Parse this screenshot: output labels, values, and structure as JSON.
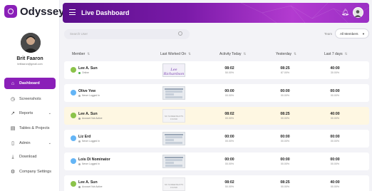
{
  "brand": {
    "name": "Odyssey"
  },
  "profile": {
    "name": "Brit Faaron",
    "email": "britfaaron@gmail.com"
  },
  "nav": [
    {
      "label": "Dashboard",
      "icon": "home-icon",
      "active": true
    },
    {
      "label": "Screenshots",
      "icon": "clock-icon"
    },
    {
      "label": "Reports",
      "icon": "chart-line-icon",
      "chevron": true
    },
    {
      "label": "Tables & Projects",
      "icon": "clipboard-icon"
    },
    {
      "label": "Admin",
      "icon": "document-icon",
      "chevron": true
    },
    {
      "label": "Download",
      "icon": "download-icon"
    },
    {
      "label": "Company Settings",
      "icon": "settings-icon"
    }
  ],
  "header": {
    "title": "Live Dashboard"
  },
  "toolbar": {
    "search_placeholder": "Search User",
    "team_label": "Team",
    "team_value": "All Members"
  },
  "columns": {
    "member": "Member",
    "last_worked": "Last Worked On",
    "today": "Activity Today",
    "yesterday": "Yesterday",
    "last7": "Last 7 days"
  },
  "rows": [
    {
      "name": "Lee A. Sun",
      "status": "Online",
      "status_color": "#4caf50",
      "avatar_color": "#8bc34a",
      "thumb": "signature",
      "thumb_text": "Lee Richardson",
      "today": "08:02",
      "today_pct": "50.00%",
      "yesterday": "08:25",
      "yesterday_pct": "87.00%",
      "last7": "40:00",
      "last7_pct": "30.00%"
    },
    {
      "name": "Olive Yew",
      "status": "Never Logged In",
      "status_color": "#b0b0b0",
      "avatar_color": "#64b5f6",
      "thumb": "screen",
      "thumb_text": "",
      "today": "00:00",
      "today_pct": "00.00%",
      "yesterday": "00:00",
      "yesterday_pct": "00.00%",
      "last7": "00:00",
      "last7_pct": "00.00%"
    },
    {
      "name": "Lee A. Sun",
      "status": "Account Not Active",
      "status_color": "#9e9e9e",
      "avatar_color": "#8bc34a",
      "thumb": "none",
      "thumb_text": "NO SCREENSHOTS FOUND",
      "today": "08:02",
      "today_pct": "00.00%",
      "yesterday": "08:25",
      "yesterday_pct": "00.00%",
      "last7": "40:00",
      "last7_pct": "00.00%",
      "highlight": true
    },
    {
      "name": "Liz Erd",
      "status": "Never Logged In",
      "status_color": "#b0b0b0",
      "avatar_color": "#64b5f6",
      "thumb": "screen",
      "thumb_text": "",
      "today": "00:00",
      "today_pct": "00.00%",
      "yesterday": "00:00",
      "yesterday_pct": "00.00%",
      "last7": "00:00",
      "last7_pct": "00.00%"
    },
    {
      "name": "Lois Di Nominator",
      "status": "Never Logged In",
      "status_color": "#b0b0b0",
      "avatar_color": "#64b5f6",
      "thumb": "screen",
      "thumb_text": "",
      "today": "00:00",
      "today_pct": "00.00%",
      "yesterday": "00:00",
      "yesterday_pct": "00.00%",
      "last7": "00:00",
      "last7_pct": "00.00%"
    },
    {
      "name": "Lee A. Sun",
      "status": "Account Not Active",
      "status_color": "#9e9e9e",
      "avatar_color": "#8bc34a",
      "thumb": "none",
      "thumb_text": "NO SCREENSHOTS FOUND",
      "today": "08:02",
      "today_pct": "50.00%",
      "yesterday": "08:25",
      "yesterday_pct": "00.00%",
      "last7": "40:00",
      "last7_pct": "00.00%"
    }
  ]
}
